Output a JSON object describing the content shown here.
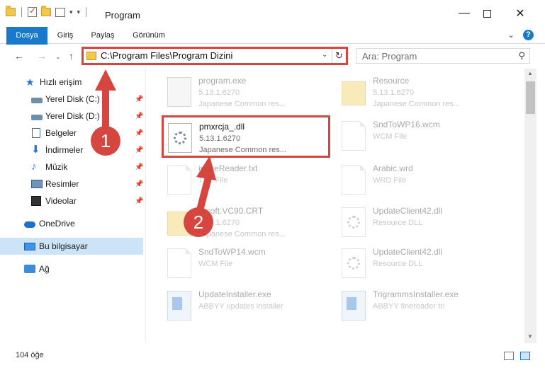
{
  "window": {
    "title": "Program",
    "minimize_glyph": "—",
    "close_glyph": "✕"
  },
  "ribbon": {
    "tabs": [
      "Dosya",
      "Giriş",
      "Paylaş",
      "Görünüm"
    ],
    "help": "?"
  },
  "address": {
    "path": "C:\\Program Files\\Program Dizini"
  },
  "search": {
    "placeholder": "Ara: Program"
  },
  "sidebar": {
    "items": [
      {
        "label": "Hızlı erişim",
        "icon": "star-icon"
      },
      {
        "label": "Yerel Disk (C:)",
        "icon": "drive-icon",
        "pinned": true
      },
      {
        "label": "Yerel Disk (D:)",
        "icon": "drive-icon",
        "pinned": true
      },
      {
        "label": "Belgeler",
        "icon": "documents-icon",
        "pinned": true
      },
      {
        "label": "İndirmeler",
        "icon": "download-icon",
        "pinned": true
      },
      {
        "label": "Müzik",
        "icon": "music-icon",
        "pinned": true
      },
      {
        "label": "Resimler",
        "icon": "pictures-icon",
        "pinned": true
      },
      {
        "label": "Videolar",
        "icon": "videos-icon",
        "pinned": true
      },
      {
        "label": "OneDrive",
        "icon": "cloud-icon"
      },
      {
        "label": "Bu bilgisayar",
        "icon": "computer-icon",
        "selected": true
      },
      {
        "label": "Ağ",
        "icon": "network-icon"
      }
    ]
  },
  "files": [
    {
      "name": "program.exe",
      "line2": "5.13.1.6270",
      "line3": "Japanese Common res...",
      "icon": "app"
    },
    {
      "name": "Resource",
      "line2": "5.13.1.6270",
      "line3": "Japanese Common res...",
      "icon": "folder"
    },
    {
      "name": "pmxrcja_.dll",
      "line2": "5.13.1.6270",
      "line3": "Japanese Common res...",
      "icon": "gear",
      "highlight": true
    },
    {
      "name": "SndToWP16.wcm",
      "line2": "WCM File",
      "line3": "",
      "icon": "page"
    },
    {
      "name": "ipfineReader.txt",
      "line2": "TXT File",
      "line3": "",
      "icon": "page"
    },
    {
      "name": "Arabic.wrd",
      "line2": "WRD File",
      "line3": "",
      "icon": "page"
    },
    {
      "name": "rosoft.VC90.CRT",
      "line2": "5.13.1.6270",
      "line3": "Japanese Common res...",
      "icon": "folder"
    },
    {
      "name": "UpdateClient42.dll",
      "line2": "Resource DLL",
      "line3": "",
      "icon": "gear"
    },
    {
      "name": "SndToWP14.wcm",
      "line2": "WCM File",
      "line3": "",
      "icon": "page"
    },
    {
      "name": "UpdateClient42.dll",
      "line2": "Resource DLL",
      "line3": "",
      "icon": "gear"
    },
    {
      "name": "UpdateInstaller.exe",
      "line2": "ABBYY updates installer",
      "line3": "",
      "icon": "exe"
    },
    {
      "name": "TrigrammsInstaller.exe",
      "line2": "ABBYY finereader tri",
      "line3": "",
      "icon": "exe"
    }
  ],
  "status": {
    "item_count": "104 öğe"
  },
  "annotations": {
    "badge1": "1",
    "badge2": "2",
    "highlight_color": "#d4463f"
  }
}
